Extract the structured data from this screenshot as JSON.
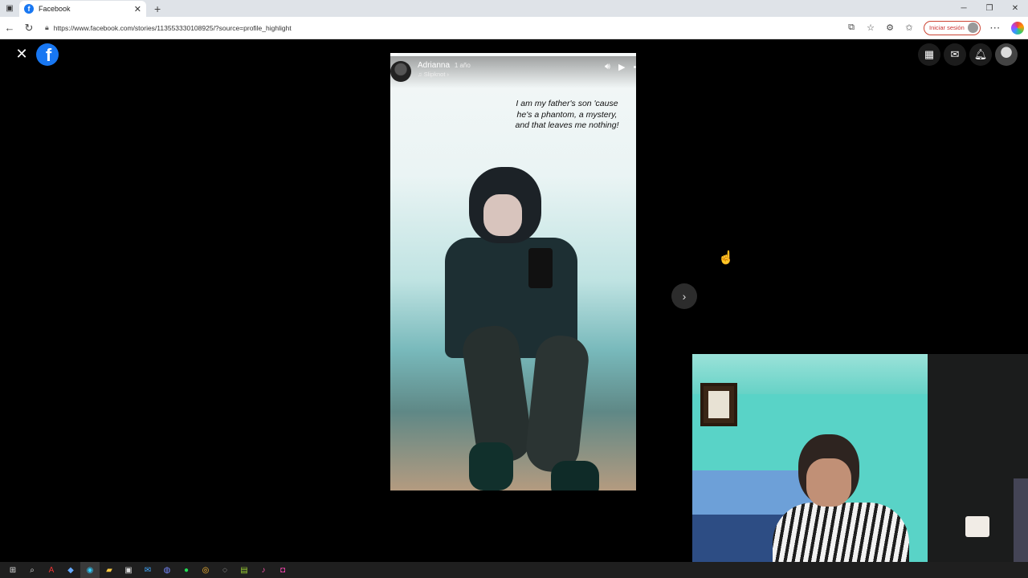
{
  "browser": {
    "tab_title": "Facebook",
    "new_tab": "+",
    "url": "https://www.facebook.com/stories/113553330108925/?source=profile_highlight",
    "login_label": "Iniciar sesión"
  },
  "story": {
    "author": "Adrianna",
    "time_ago": "1 año",
    "song": "Slipknot",
    "quote": "I am my father's son 'cause he's a phantom, a mystery, and that leaves me nothing!",
    "progress": 0.03
  },
  "icons": {
    "tab_menu": "tab-actions-icon",
    "close": "close-icon",
    "next": "chevron-right-icon",
    "grid": "grid-menu-icon",
    "messenger": "messenger-icon",
    "notifications": "bell-icon"
  },
  "colors": {
    "facebook_blue": "#1877f2",
    "login_red": "#cc3333"
  }
}
